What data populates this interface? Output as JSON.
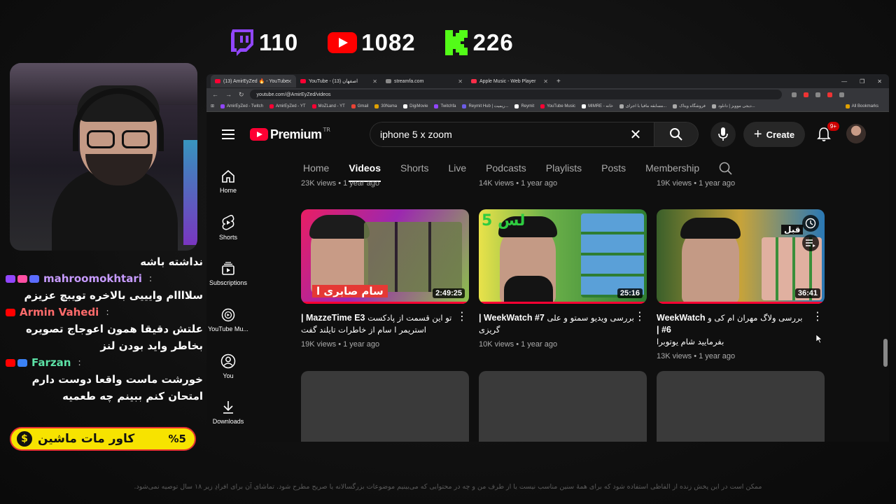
{
  "stream_stats": {
    "twitch_count": "110",
    "youtube_count": "1082",
    "kick_count": "226",
    "colors": {
      "twitch": "#9146ff",
      "youtube": "#ff0000",
      "kick": "#53fc18"
    }
  },
  "chat": {
    "messages": [
      {
        "user": "",
        "text": "نداشته باشه"
      },
      {
        "user": "mahroomokhtari",
        "user_color": "#c79bff",
        "text": "سلاااام وایییی بالاخره تویبچ عزیزم"
      },
      {
        "user": "Armin Vahedi",
        "user_color": "#ff6b6b",
        "text": "علتش دقیقا همون اعوجاج تصویره بخاطر واید بودن لنز"
      },
      {
        "user": "Farzan",
        "user_color": "#5ce1a6",
        "text": "خورشت ماست واقعا دوست دارم امتحان کنم ببینم چه طعمیه"
      }
    ],
    "colon": ":"
  },
  "cover_banner": {
    "text": "کاور مات ماشین",
    "percent": "%5",
    "coin": "$"
  },
  "disclaimer": "ممکن است در این پخش زنده از الفاظی استفاده شود که برای همهٔ سنین مناسب نیست یا از طرف من و چه در محتوایی که می‌بینیم موضوعات بزرگسالانه یا صریح مطرح شود. تماشای آن برای افرادِ زیر ۱۸ سال توصیه نمی‌شود.",
  "browser": {
    "tabs": [
      {
        "label": "(13) AmirEyZed 🔥 - YouTube",
        "color": "#ff0033",
        "active": true
      },
      {
        "label": "YouTube - اصفهان (13)",
        "color": "#ff0033",
        "active": false
      },
      {
        "label": "streamfa.com",
        "color": "#888888",
        "active": false
      },
      {
        "label": "Apple Music - Web Player",
        "color": "#fa2d48",
        "active": false
      }
    ],
    "url": "youtube.com/@AmirEyZed/videos",
    "bookmarks": [
      {
        "label": "AmirEyZed - Twitch",
        "color": "#9146ff"
      },
      {
        "label": "AmirEyZed - YT",
        "color": "#ff0033"
      },
      {
        "label": "MoZLand - YT",
        "color": "#ff0033"
      },
      {
        "label": "Gmail",
        "color": "#ea4335"
      },
      {
        "label": "30Nama",
        "color": "#e0a100"
      },
      {
        "label": "DigiMovie",
        "color": "#ffffff"
      },
      {
        "label": "Twitchfa",
        "color": "#9146ff"
      },
      {
        "label": "Reymit Hub | ریمیت...",
        "color": "#6c5ce7"
      },
      {
        "label": "Reymit",
        "color": "#ffffff"
      },
      {
        "label": "YouTube Music",
        "color": "#ff0033"
      },
      {
        "label": "MIMRE - خانه",
        "color": "#ffffff"
      },
      {
        "label": "مسابقه مافیا با اجرای...",
        "color": "#aaaaaa"
      },
      {
        "label": "فروشگاه ویتاک",
        "color": "#aaaaaa"
      },
      {
        "label": "دیجی موویز | دانلود...",
        "color": "#aaaaaa"
      }
    ],
    "all_bookmarks": "All Bookmarks"
  },
  "youtube": {
    "logo_text": "Premium",
    "region": "TR",
    "search_value": "iphone 5 x zoom",
    "create_label": "Create",
    "notif_count": "9+",
    "sidebar": [
      {
        "label": "Home",
        "icon": "home-icon"
      },
      {
        "label": "Shorts",
        "icon": "shorts-icon"
      },
      {
        "label": "Subscriptions",
        "icon": "subscriptions-icon"
      },
      {
        "label": "YouTube Mu...",
        "icon": "youtube-music-icon"
      },
      {
        "label": "You",
        "icon": "you-icon"
      },
      {
        "label": "Downloads",
        "icon": "downloads-icon"
      }
    ],
    "tabs": [
      "Home",
      "Videos",
      "Shorts",
      "Live",
      "Podcasts",
      "Playlists",
      "Posts",
      "Membership"
    ],
    "active_tab": "Videos",
    "prev_row_meta": [
      "23K views • 1 year ago",
      "14K views • 1 year ago",
      "19K views • 1 year ago"
    ],
    "videos": [
      {
        "title_fa": "تو این قسمت از پادکست",
        "title_en": "MazzeTime E3 |",
        "title_line2": "استریمر ا سام از خاطرات تایلند گفت",
        "meta": "19K views • 1 year ago",
        "duration": "2:49:25",
        "progress": 1.0,
        "overlay_text": "سام صابری ا",
        "thumb_bg": "#c2185b"
      },
      {
        "title_fa": "بررسی ویدیو سمتو و علی",
        "title_en": "WeekWatch #7 |",
        "title_line2": "گریزی",
        "meta": "10K views • 1 year ago",
        "duration": "25:16",
        "progress": 1.0,
        "overlay_text": "لس 5",
        "thumb_bg": "#1f5e3a"
      },
      {
        "title_fa": "بررسی ولاگ مهران ام کی و",
        "title_en": "WeekWatch #6 |",
        "title_line2": "بفرمایید شام یوتوبرا",
        "meta": "13K views • 1 year ago",
        "duration": "36:41",
        "progress": 1.0,
        "overlay_text": "قبل",
        "thumb_bg": "#2b4a2a"
      }
    ]
  }
}
